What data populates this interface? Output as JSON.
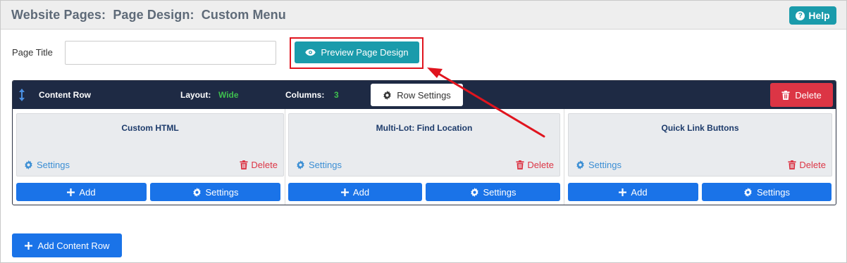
{
  "header": {
    "title": "Website Pages:  Page Design:  Custom Menu",
    "help_label": "Help",
    "help_icon": "question-circle-icon"
  },
  "form": {
    "page_title_label": "Page Title",
    "page_title_value": "",
    "page_title_placeholder": "",
    "preview_label": "Preview Page Design",
    "preview_icon": "eye-icon"
  },
  "content_row": {
    "label": "Content Row",
    "layout_label": "Layout:",
    "layout_value": "Wide",
    "columns_label": "Columns:",
    "columns_value": "3",
    "row_settings_label": "Row Settings",
    "delete_label": "Delete",
    "columns": [
      {
        "widget_title": "Custom HTML",
        "settings_label": "Settings",
        "delete_label": "Delete",
        "add_label": "Add",
        "col_settings_label": "Settings"
      },
      {
        "widget_title": "Multi-Lot: Find Location",
        "settings_label": "Settings",
        "delete_label": "Delete",
        "add_label": "Add",
        "col_settings_label": "Settings"
      },
      {
        "widget_title": "Quick Link Buttons",
        "settings_label": "Settings",
        "delete_label": "Delete",
        "add_label": "Add",
        "col_settings_label": "Settings"
      }
    ]
  },
  "add_content_row_label": "Add Content Row",
  "colors": {
    "header_bg": "#eeeeee",
    "teal": "#1a9bab",
    "navy": "#1e2a44",
    "green": "#3fbf4f",
    "red": "#dc3545",
    "blue": "#1a73e8",
    "link_blue": "#3b8ed4",
    "annotation_red": "#e0141e"
  }
}
